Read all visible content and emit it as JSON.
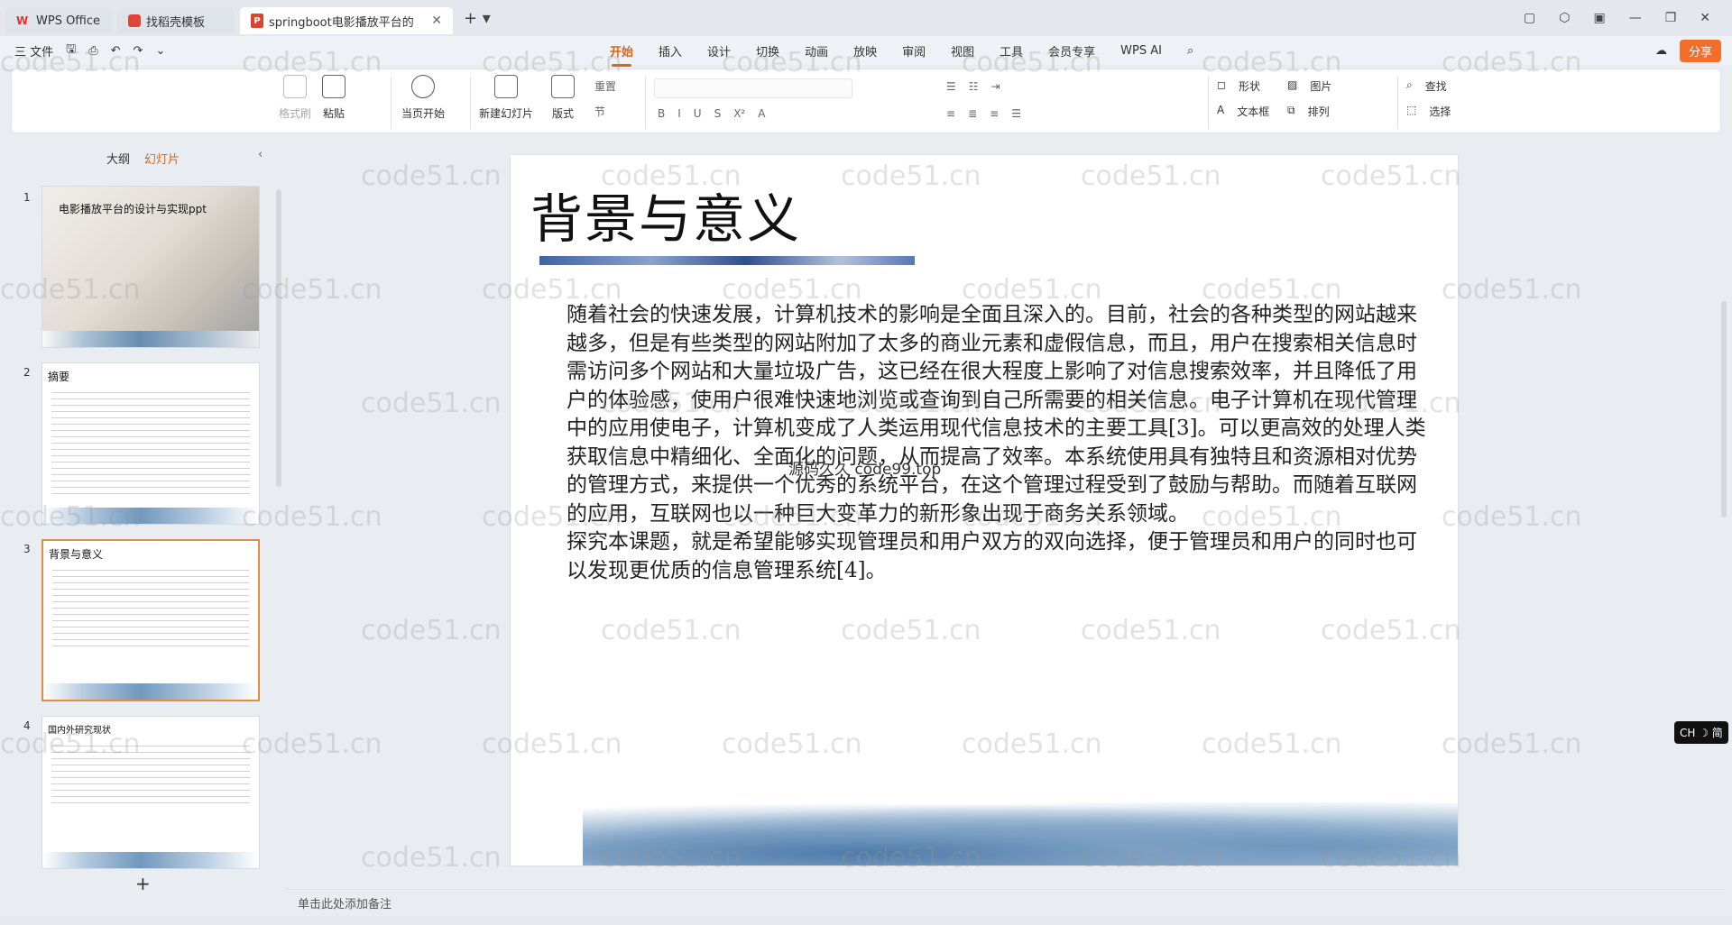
{
  "tabs": {
    "home": "WPS Office",
    "template": "找稻壳模板",
    "active": "springboot电影播放平台的"
  },
  "menu": {
    "file": "三 文件",
    "tabs": [
      "开始",
      "插入",
      "设计",
      "切换",
      "动画",
      "放映",
      "审阅",
      "视图",
      "工具",
      "会员专享"
    ],
    "wps_ai": "WPS AI",
    "share": "分享"
  },
  "ribbon": {
    "format_painter": "格式刷",
    "paste": "粘贴",
    "play_current": "当页开始",
    "new_slide": "新建幻灯片",
    "layout": "版式",
    "reset": "重置",
    "section": "节",
    "shape": "形状",
    "picture": "图片",
    "textbox": "文本框",
    "arrange": "排列",
    "find": "查找",
    "select": "选择"
  },
  "panel": {
    "outline": "大纲",
    "slides": "幻灯片",
    "thumbs": [
      {
        "num": "1",
        "title": "电影播放平台的设计与实现ppt"
      },
      {
        "num": "2",
        "title": "摘要"
      },
      {
        "num": "3",
        "title": "背景与意义"
      },
      {
        "num": "4",
        "title": "国内外研究现状"
      }
    ]
  },
  "slide": {
    "title": "背景与意义",
    "para1": "随着社会的快速发展，计算机技术的影响是全面且深入的。目前，社会的各种类型的网站越来越多，但是有些类型的网站附加了太多的商业元素和虚假信息，而且，用户在搜索相关信息时需访问多个网站和大量垃圾广告，这已经在很大程度上影响了对信息搜索效率，并且降低了用户的体验感，使用户很难快速地浏览或查询到自己所需要的相关信息。电子计算机在现代管理中的应用使电子，计算机变成了人类运用现代信息技术的主要工具[3]。可以更高效的处理人类获取信息中精细化、全面化的问题，从而提高了效率。本系统使用具有独特且和资源相对优势的管理方式，来提供一个优秀的系统平台，在这个管理过程受到了鼓励与帮助。而随着互联网的应用，互联网也以一种巨大变革力的新形象出现于商务关系领域。",
    "para2": "探究本课题，就是希望能够实现管理员和用户双方的双向选择，便于管理员和用户的同时也可以发现更优质的信息管理系统[4]。",
    "overlay": "源码久久 code99.top"
  },
  "notes_placeholder": "单击此处添加备注",
  "ime": "CH ☽ 简",
  "watermark": "code51.cn"
}
